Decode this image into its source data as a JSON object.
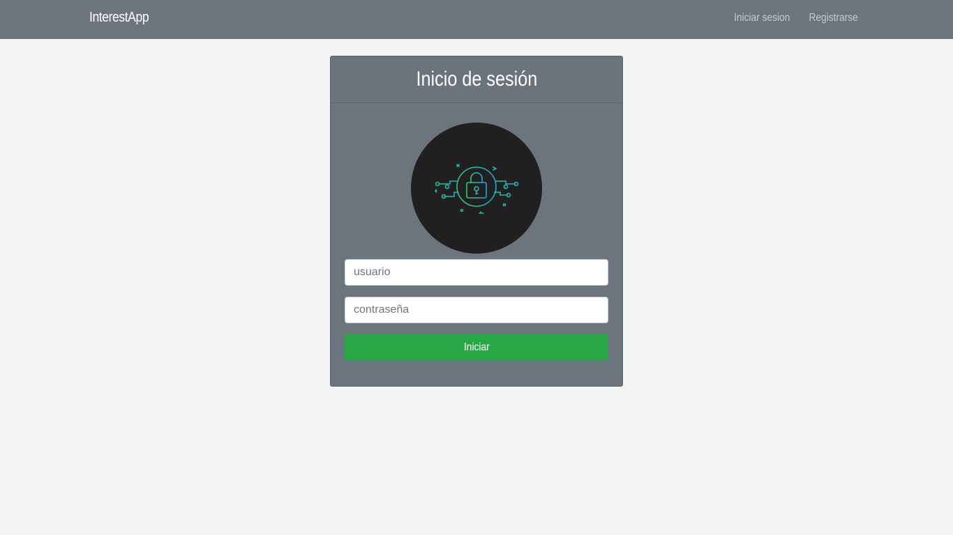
{
  "navbar": {
    "brand": "InterestApp",
    "links": [
      {
        "label": "Iniciar sesion"
      },
      {
        "label": "Registrarse"
      }
    ]
  },
  "login_card": {
    "title": "Inicio de sesión",
    "avatar_icon": "lock-circuit-icon",
    "username_placeholder": "usuario",
    "password_placeholder": "contraseña",
    "submit_label": "Iniciar"
  },
  "colors": {
    "navbar_bg": "#6c757d",
    "page_bg": "#f4f6f5",
    "card_bg": "#6c757d",
    "button_bg": "#28a745",
    "icon_green": "#1fd08a",
    "icon_blue": "#1ab0d8"
  }
}
